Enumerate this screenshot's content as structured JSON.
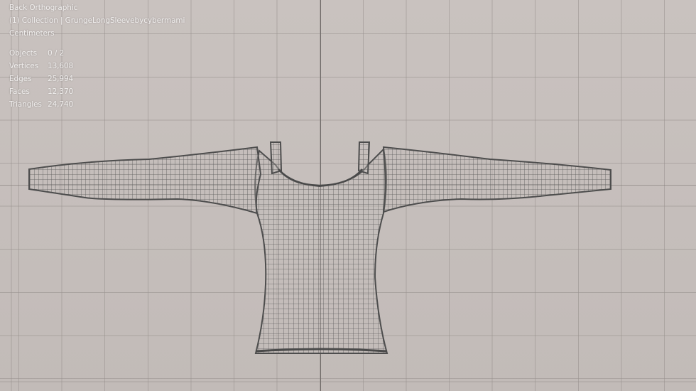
{
  "viewport": {
    "view_name": "Back Orthographic",
    "collection": "(1) Collection | GrungeLongSleevebycybermami",
    "units": "Centimeters"
  },
  "stats": [
    {
      "label": "Objects",
      "value": "0 / 2"
    },
    {
      "label": "Vertices",
      "value": "13,608"
    },
    {
      "label": "Edges",
      "value": "25,994"
    },
    {
      "label": "Faces",
      "value": "12,370"
    },
    {
      "label": "Triangles",
      "value": "24,740"
    }
  ],
  "colors": {
    "background": "#c7bfbb",
    "grid": "#968f8c",
    "wire": "#5a5a5a",
    "text": "#f1efee"
  },
  "icons": {
    "mesh": "wireframe-shirt-mesh"
  }
}
